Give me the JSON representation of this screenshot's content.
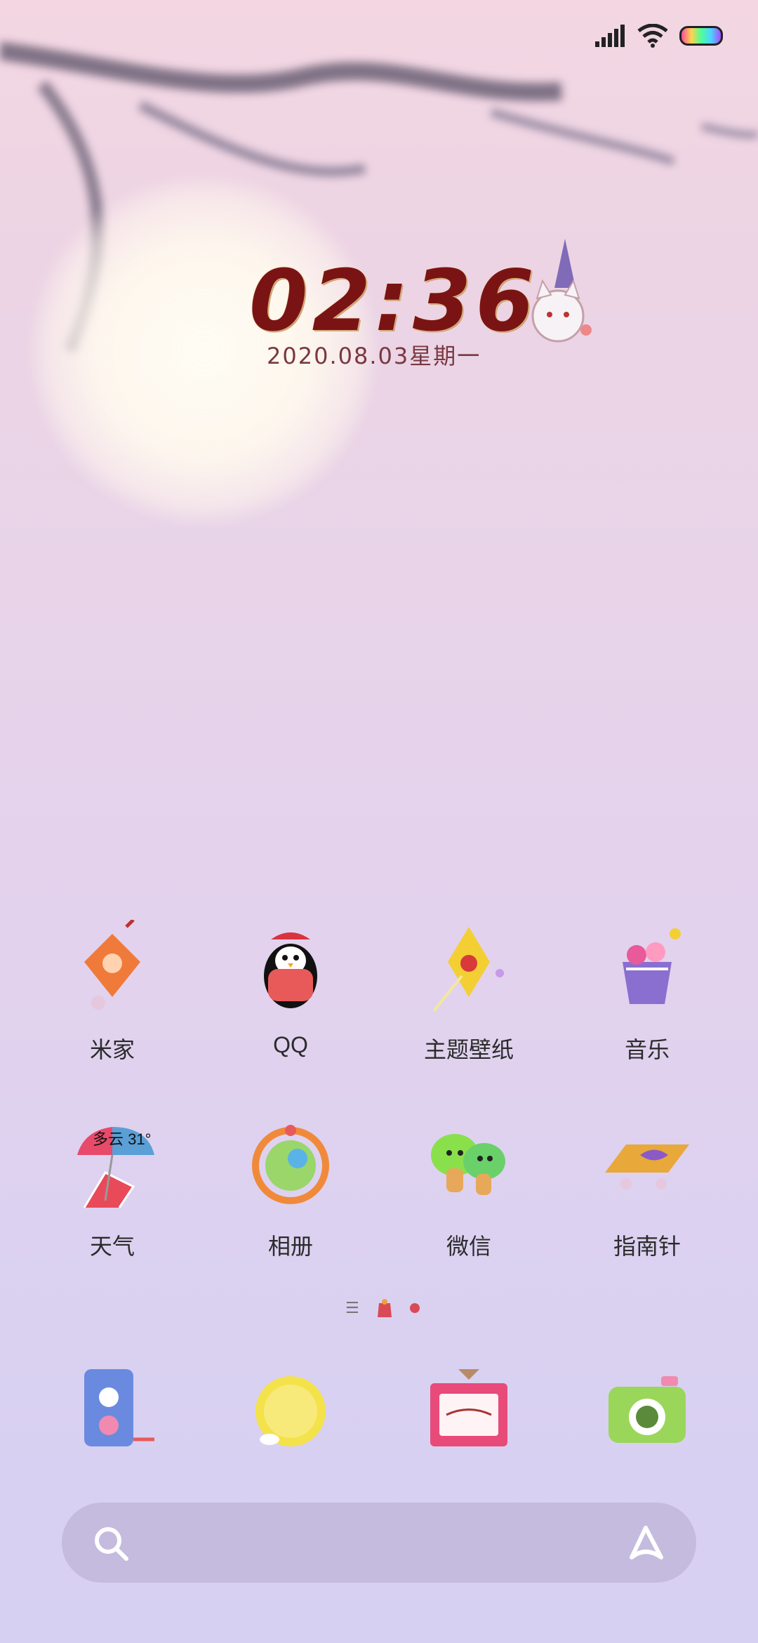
{
  "status": {
    "signal": "signal-icon",
    "wifi": "wifi-icon",
    "battery": "battery-icon"
  },
  "clock": {
    "time": "02:36",
    "date": "2020.08.03星期一"
  },
  "apps": [
    {
      "label": "米家",
      "icon": "mijia-icon"
    },
    {
      "label": "QQ",
      "icon": "qq-penguin-icon"
    },
    {
      "label": "主题壁纸",
      "icon": "themes-icon"
    },
    {
      "label": "音乐",
      "icon": "music-icon"
    },
    {
      "label": "天气",
      "icon": "weather-icon"
    },
    {
      "label": "相册",
      "icon": "gallery-icon"
    },
    {
      "label": "微信",
      "icon": "wechat-icon"
    },
    {
      "label": "指南针",
      "icon": "compass-icon"
    }
  ],
  "weather_chip": "多云 31°",
  "pager": {
    "current": 2,
    "total": 2
  },
  "dock": [
    "phone-icon",
    "messages-icon",
    "browser-icon",
    "camera-icon"
  ],
  "colors": {
    "clock": "#7a1414",
    "accent_dot": "#d84a56"
  }
}
